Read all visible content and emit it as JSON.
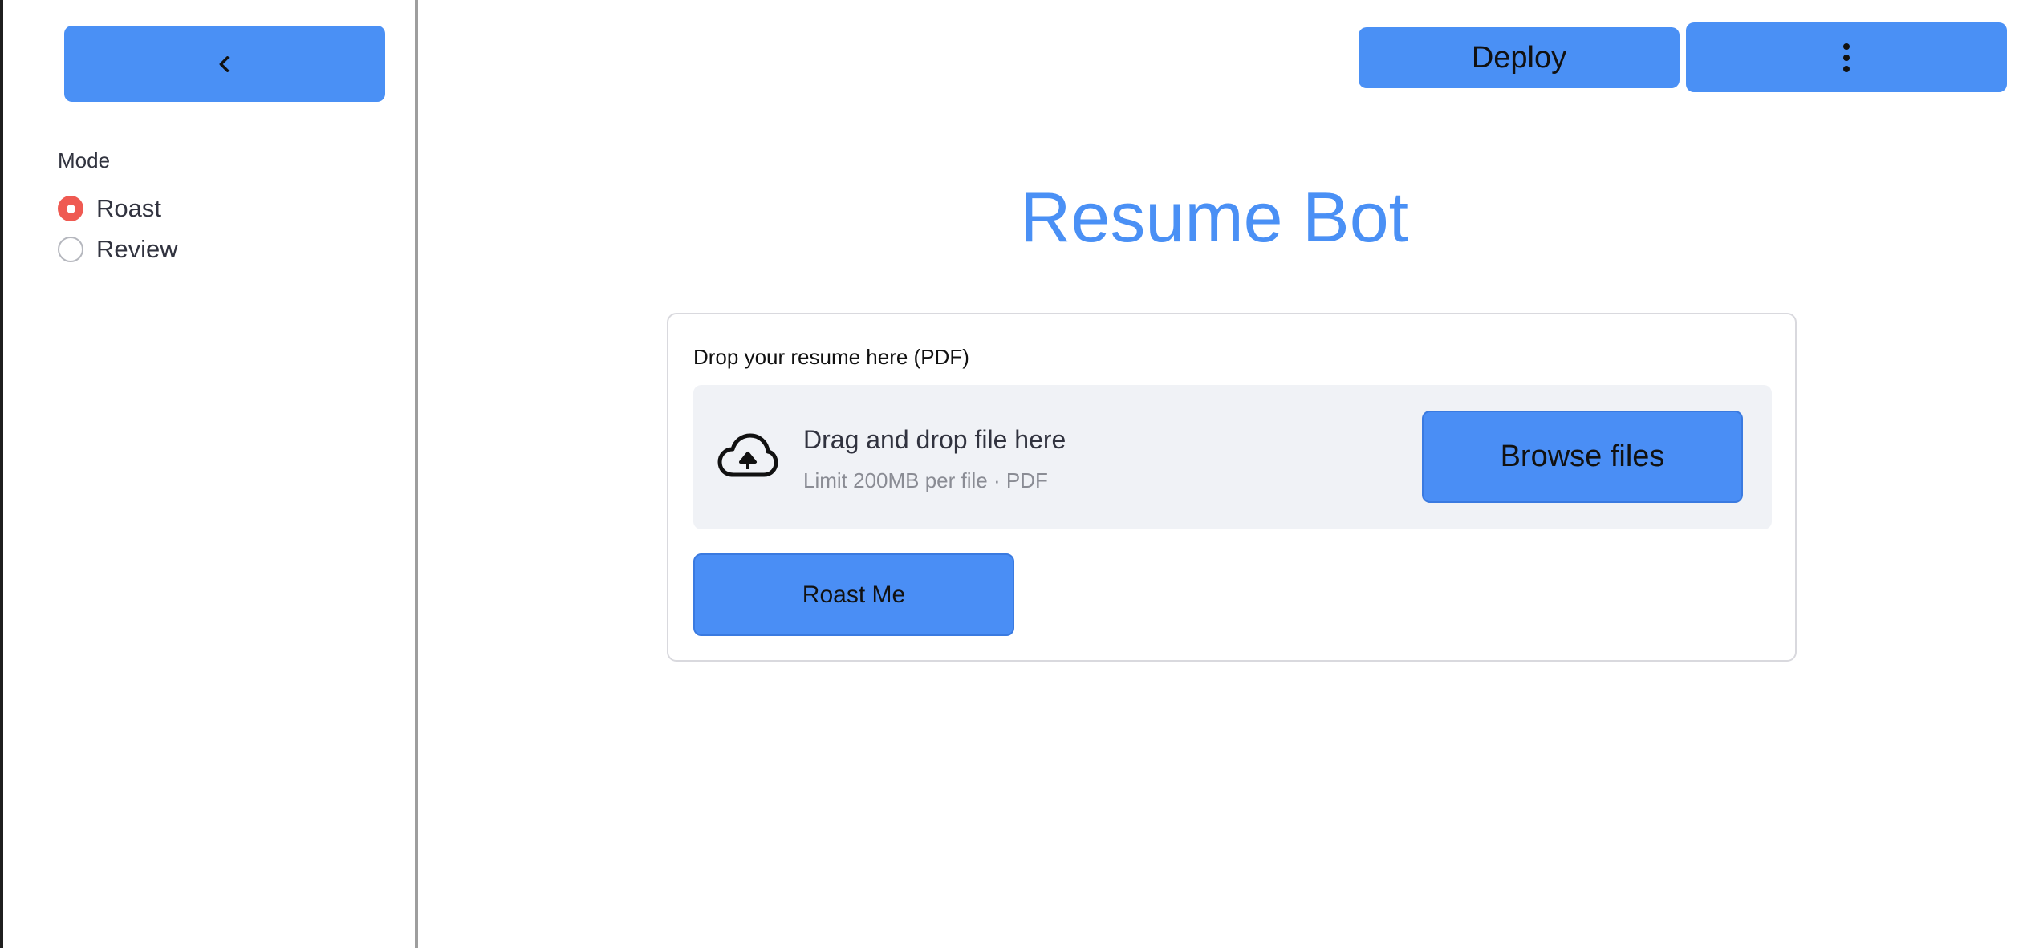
{
  "sidebar": {
    "collapse_icon": "chevron-left-icon",
    "mode_label": "Mode",
    "mode_options": [
      {
        "label": "Roast",
        "selected": true
      },
      {
        "label": "Review",
        "selected": false
      }
    ]
  },
  "toolbar": {
    "deploy_label": "Deploy",
    "menu_icon": "more-vertical-icon"
  },
  "main": {
    "title": "Resume Bot",
    "uploader": {
      "label": "Drop your resume here (PDF)",
      "drop_title": "Drag and drop file here",
      "drop_subtitle": "Limit 200MB per file · PDF",
      "browse_label": "Browse files",
      "icon": "cloud-upload-icon"
    },
    "submit_label": "Roast Me"
  },
  "colors": {
    "accent": "#4a90f5",
    "radio_selected": "#ef5a52",
    "dropzone_bg": "#f0f2f6"
  }
}
